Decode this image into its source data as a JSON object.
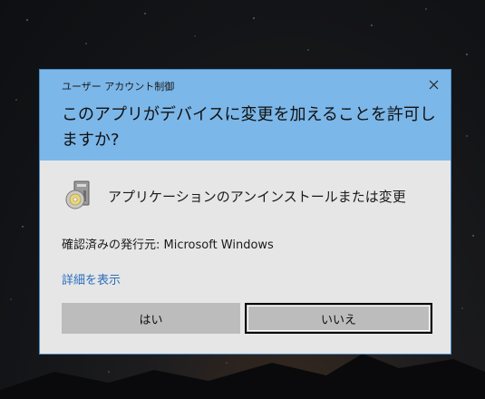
{
  "dialog": {
    "window_title": "ユーザー アカウント制御",
    "question": "このアプリがデバイスに変更を加えることを許可しますか?",
    "app_name": "アプリケーションのアンインストールまたは変更",
    "publisher": "確認済みの発行元: Microsoft Windows",
    "details_link": "詳細を表示",
    "yes_label": "はい",
    "no_label": "いいえ"
  },
  "icons": {
    "close": "close-icon",
    "app": "installer-disc-icon"
  },
  "colors": {
    "header_bg": "#7cb7e9",
    "body_bg": "#e6e6e6",
    "link": "#2a6fbd",
    "button_bg": "#bcbcbc"
  }
}
